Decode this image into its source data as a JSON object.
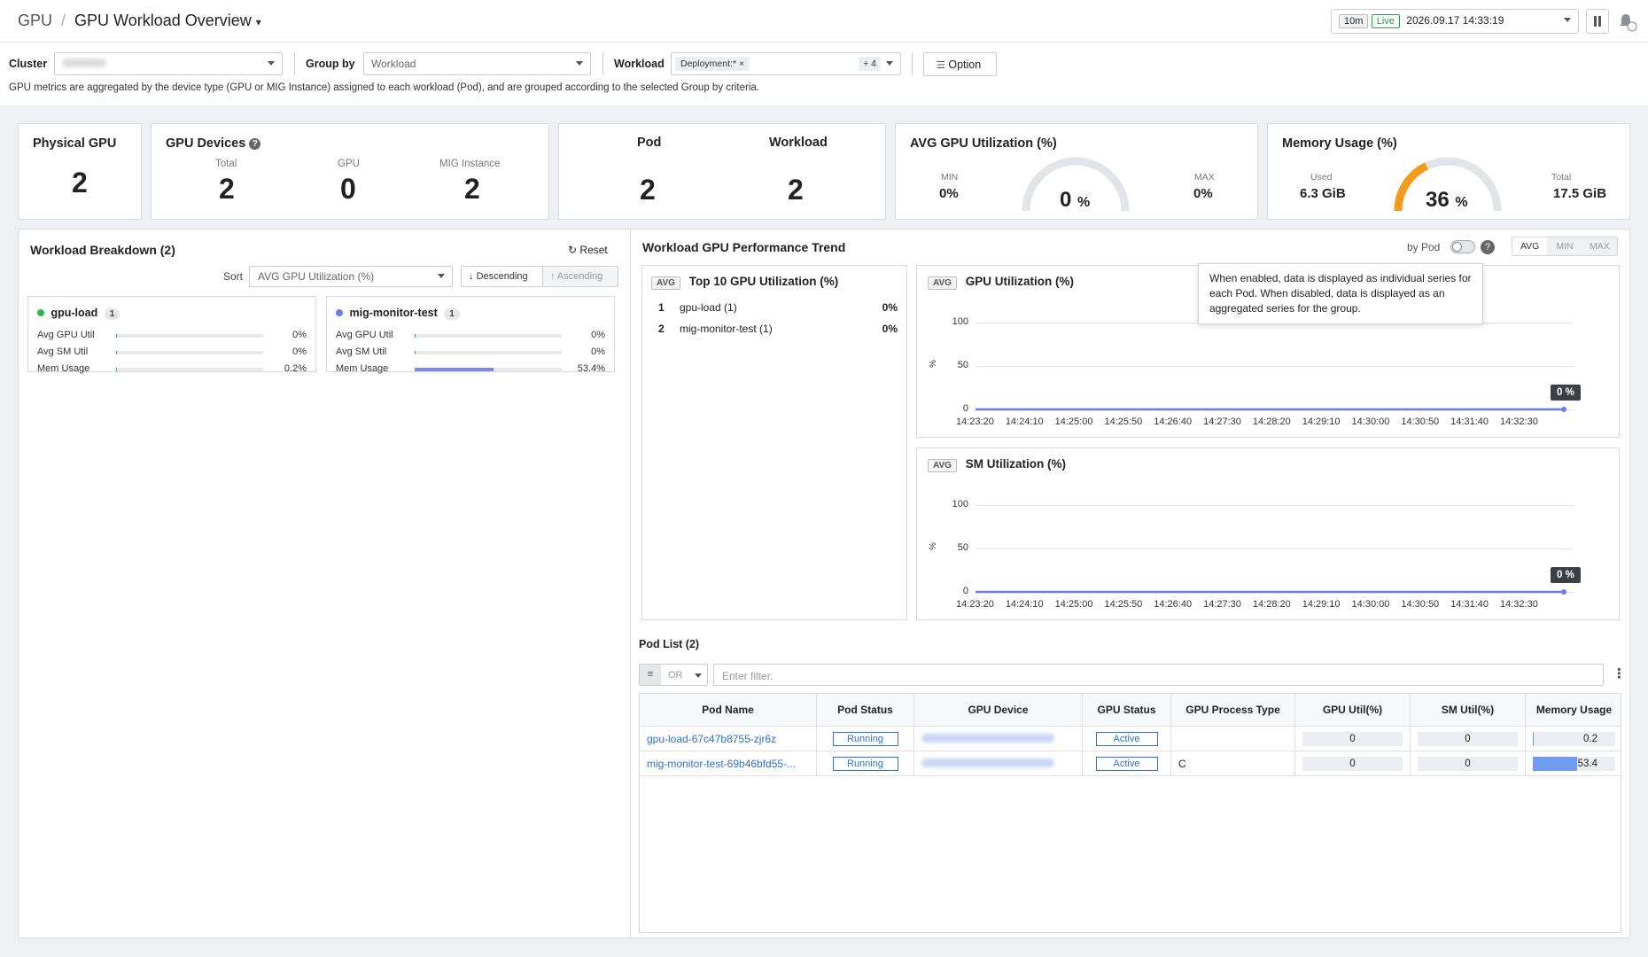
{
  "header": {
    "breadcrumb_root": "GPU",
    "title": "GPU Workload Overview",
    "time_range": "10m",
    "live_label": "Live",
    "datetime": "2026.09.17 14:33:19"
  },
  "filters": {
    "cluster_label": "Cluster",
    "group_by_label": "Group by",
    "group_by_value": "Workload",
    "workload_label": "Workload",
    "workload_tag": "Deployment:*",
    "workload_more": "+ 4",
    "option_label": "Option",
    "description": "GPU metrics are aggregated by the device type (GPU or MIG Instance) assigned to each workload (Pod), and are grouped according to the selected Group by criteria."
  },
  "summary": {
    "physical_gpu": {
      "title": "Physical GPU",
      "value": "2"
    },
    "gpu_devices": {
      "title": "GPU Devices",
      "total_label": "Total",
      "total": "2",
      "gpu_label": "GPU",
      "gpu": "0",
      "mig_label": "MIG Instance",
      "mig": "2"
    },
    "pod": {
      "title": "Pod",
      "value": "2"
    },
    "workload": {
      "title": "Workload",
      "value": "2"
    },
    "avg_util": {
      "title": "AVG GPU Utilization (%)",
      "min_label": "MIN",
      "min": "0%",
      "max_label": "MAX",
      "max": "0%",
      "value": "0",
      "unit": "%",
      "gauge_fraction": 0
    },
    "memory": {
      "title": "Memory Usage (%)",
      "used_label": "Used",
      "used": "6.3 GiB",
      "total_label": "Total",
      "total": "17.5 GiB",
      "value": "36",
      "unit": "%",
      "gauge_fraction": 0.36,
      "gauge_color": "#f59a1b"
    }
  },
  "breakdown": {
    "title": "Workload Breakdown (2)",
    "reset_label": "Reset",
    "sort_label": "Sort",
    "sort_value": "AVG GPU Utilization (%)",
    "descending_label": "Descending",
    "ascending_label": "Ascending",
    "items": [
      {
        "name": "gpu-load",
        "count": "1",
        "color": "#2db84d",
        "rows": [
          {
            "label": "Avg GPU Util",
            "value": "0%",
            "pct": 0
          },
          {
            "label": "Avg SM Util",
            "value": "0%",
            "pct": 0
          },
          {
            "label": "Mem Usage",
            "value": "0.2%",
            "pct": 0.2
          }
        ]
      },
      {
        "name": "mig-monitor-test",
        "count": "1",
        "color": "#6c7cf0",
        "rows": [
          {
            "label": "Avg GPU Util",
            "value": "0%",
            "pct": 0
          },
          {
            "label": "Avg SM Util",
            "value": "0%",
            "pct": 0
          },
          {
            "label": "Mem Usage",
            "value": "53.4%",
            "pct": 53.4
          }
        ]
      }
    ]
  },
  "trend": {
    "title": "Workload GPU Performance Trend",
    "by_pod_label": "by Pod",
    "seg": [
      "AVG",
      "MIN",
      "MAX"
    ],
    "tooltip": "When enabled, data is displayed as individual series for each Pod. When disabled, data is displayed as an aggregated series for the group.",
    "top10": {
      "badge": "AVG",
      "title": "Top 10 GPU Utilization (%)",
      "rows": [
        {
          "rank": "1",
          "name": "gpu-load (1)",
          "value": "0%"
        },
        {
          "rank": "2",
          "name": "mig-monitor-test (1)",
          "value": "0%"
        }
      ]
    }
  },
  "chart_data": [
    {
      "type": "line",
      "title": "GPU Utilization (%)",
      "badge": "AVG",
      "ylabel": "%",
      "ylim": [
        0,
        100
      ],
      "yticks": [
        "100",
        "50",
        "0"
      ],
      "x": [
        "14:23:20",
        "14:24:10",
        "14:25:00",
        "14:25:50",
        "14:26:40",
        "14:27:30",
        "14:28:20",
        "14:29:10",
        "14:30:00",
        "14:30:50",
        "14:31:40",
        "14:32:30"
      ],
      "series": [
        {
          "values": [
            0,
            0,
            0,
            0,
            0,
            0,
            0,
            0,
            0,
            0,
            0,
            0
          ],
          "color": "#6c7cf0"
        }
      ],
      "last_label": "0 %"
    },
    {
      "type": "line",
      "title": "SM Utilization (%)",
      "badge": "AVG",
      "ylabel": "%",
      "ylim": [
        0,
        100
      ],
      "yticks": [
        "100",
        "50",
        "0"
      ],
      "x": [
        "14:23:20",
        "14:24:10",
        "14:25:00",
        "14:25:50",
        "14:26:40",
        "14:27:30",
        "14:28:20",
        "14:29:10",
        "14:30:00",
        "14:30:50",
        "14:31:40",
        "14:32:30"
      ],
      "series": [
        {
          "values": [
            0,
            0,
            0,
            0,
            0,
            0,
            0,
            0,
            0,
            0,
            0,
            0
          ],
          "color": "#6c7cf0"
        }
      ],
      "last_label": "0 %"
    }
  ],
  "podlist": {
    "title": "Pod List (2)",
    "or_label": "OR",
    "filter_placeholder": "Enter filter.",
    "columns": [
      "Pod Name",
      "Pod Status",
      "GPU Device",
      "GPU Status",
      "GPU Process Type",
      "GPU Util(%)",
      "SM Util(%)",
      "Memory Usage"
    ],
    "rows": [
      {
        "name": "gpu-load-67c47b8755-zjr6z",
        "status": "Running",
        "gpu_status": "Active",
        "process_type": "",
        "gpu_util": "0",
        "sm_util": "0",
        "mem": "0.2",
        "mem_pct": 0.2
      },
      {
        "name": "mig-monitor-test-69b46bfd55-...",
        "status": "Running",
        "gpu_status": "Active",
        "process_type": "C",
        "gpu_util": "0",
        "sm_util": "0",
        "mem": "53.4",
        "mem_pct": 53.4
      }
    ]
  }
}
